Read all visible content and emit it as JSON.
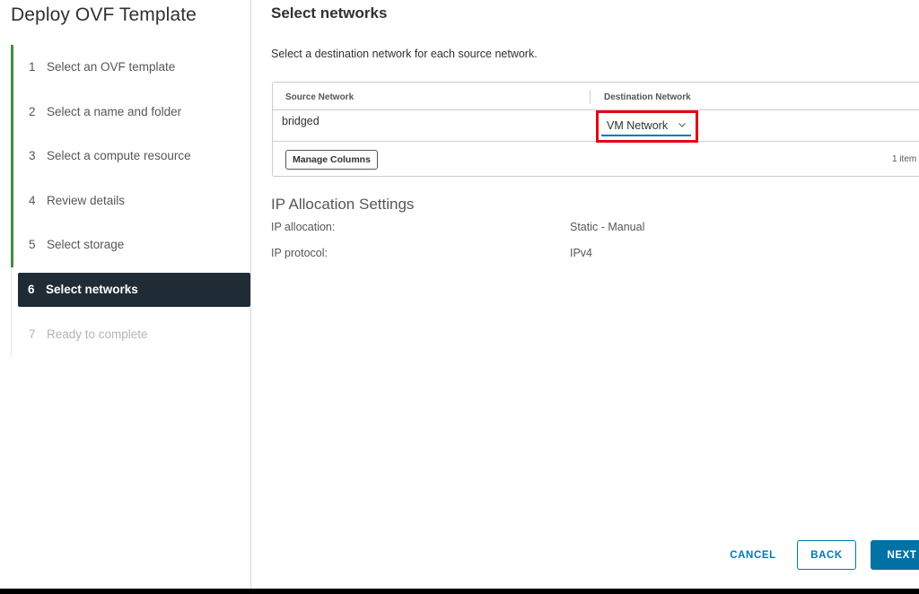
{
  "wizard": {
    "title": "Deploy OVF Template",
    "steps": [
      {
        "num": "1",
        "label": "Select an OVF template",
        "state": "done"
      },
      {
        "num": "2",
        "label": "Select a name and folder",
        "state": "done"
      },
      {
        "num": "3",
        "label": "Select a compute resource",
        "state": "done"
      },
      {
        "num": "4",
        "label": "Review details",
        "state": "done"
      },
      {
        "num": "5",
        "label": "Select storage",
        "state": "done"
      },
      {
        "num": "6",
        "label": "Select networks",
        "state": "active"
      },
      {
        "num": "7",
        "label": "Ready to complete",
        "state": "disabled"
      }
    ]
  },
  "page": {
    "title": "Select networks",
    "subtitle": "Select a destination network for each source network."
  },
  "grid": {
    "columns": [
      "Source Network",
      "Destination Network"
    ],
    "rows": [
      {
        "source": "bridged",
        "destination": "VM Network"
      }
    ],
    "manage_columns": "Manage Columns",
    "count": "1 item"
  },
  "ip": {
    "heading": "IP Allocation Settings",
    "allocation_label": "IP allocation:",
    "allocation_value": "Static - Manual",
    "protocol_label": "IP protocol:",
    "protocol_value": "IPv4"
  },
  "footer": {
    "cancel": "CANCEL",
    "back": "BACK",
    "next": "NEXT"
  },
  "colors": {
    "accent": "#0079b8",
    "done": "#3f8d3f",
    "active_bg": "#1f2b35",
    "highlight": "#e30613"
  }
}
